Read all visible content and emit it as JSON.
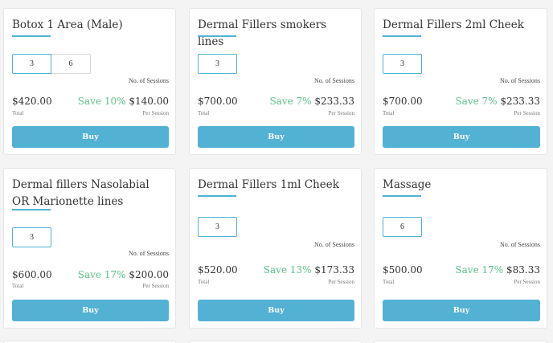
{
  "labels": {
    "sessions": "No. of Sessions",
    "total": "Total",
    "per_session": "Per Session",
    "buy": "Buy"
  },
  "packages": [
    {
      "title": "Botox 1 Area (Male)",
      "options": [
        "3",
        "6"
      ],
      "selected": "3",
      "total": "$420.00",
      "save": "Save 10%",
      "per_session": "$140.00"
    },
    {
      "title": "Dermal Fillers smokers lines",
      "options": [
        "3"
      ],
      "selected": "3",
      "total": "$700.00",
      "save": "Save 7%",
      "per_session": "$233.33"
    },
    {
      "title": "Dermal Fillers 2ml Cheek",
      "options": [
        "3"
      ],
      "selected": "3",
      "total": "$700.00",
      "save": "Save 7%",
      "per_session": "$233.33"
    },
    {
      "title": "Dermal fillers Nasolabial OR Marionette lines",
      "options": [
        "3"
      ],
      "selected": "3",
      "total": "$600.00",
      "save": "Save 17%",
      "per_session": "$200.00"
    },
    {
      "title": "Dermal Fillers 1ml Cheek",
      "options": [
        "3"
      ],
      "selected": "3",
      "total": "$520.00",
      "save": "Save 13%",
      "per_session": "$173.33"
    },
    {
      "title": "Massage",
      "options": [
        "6"
      ],
      "selected": "6",
      "total": "$500.00",
      "save": "Save 17%",
      "per_session": "$83.33"
    }
  ]
}
